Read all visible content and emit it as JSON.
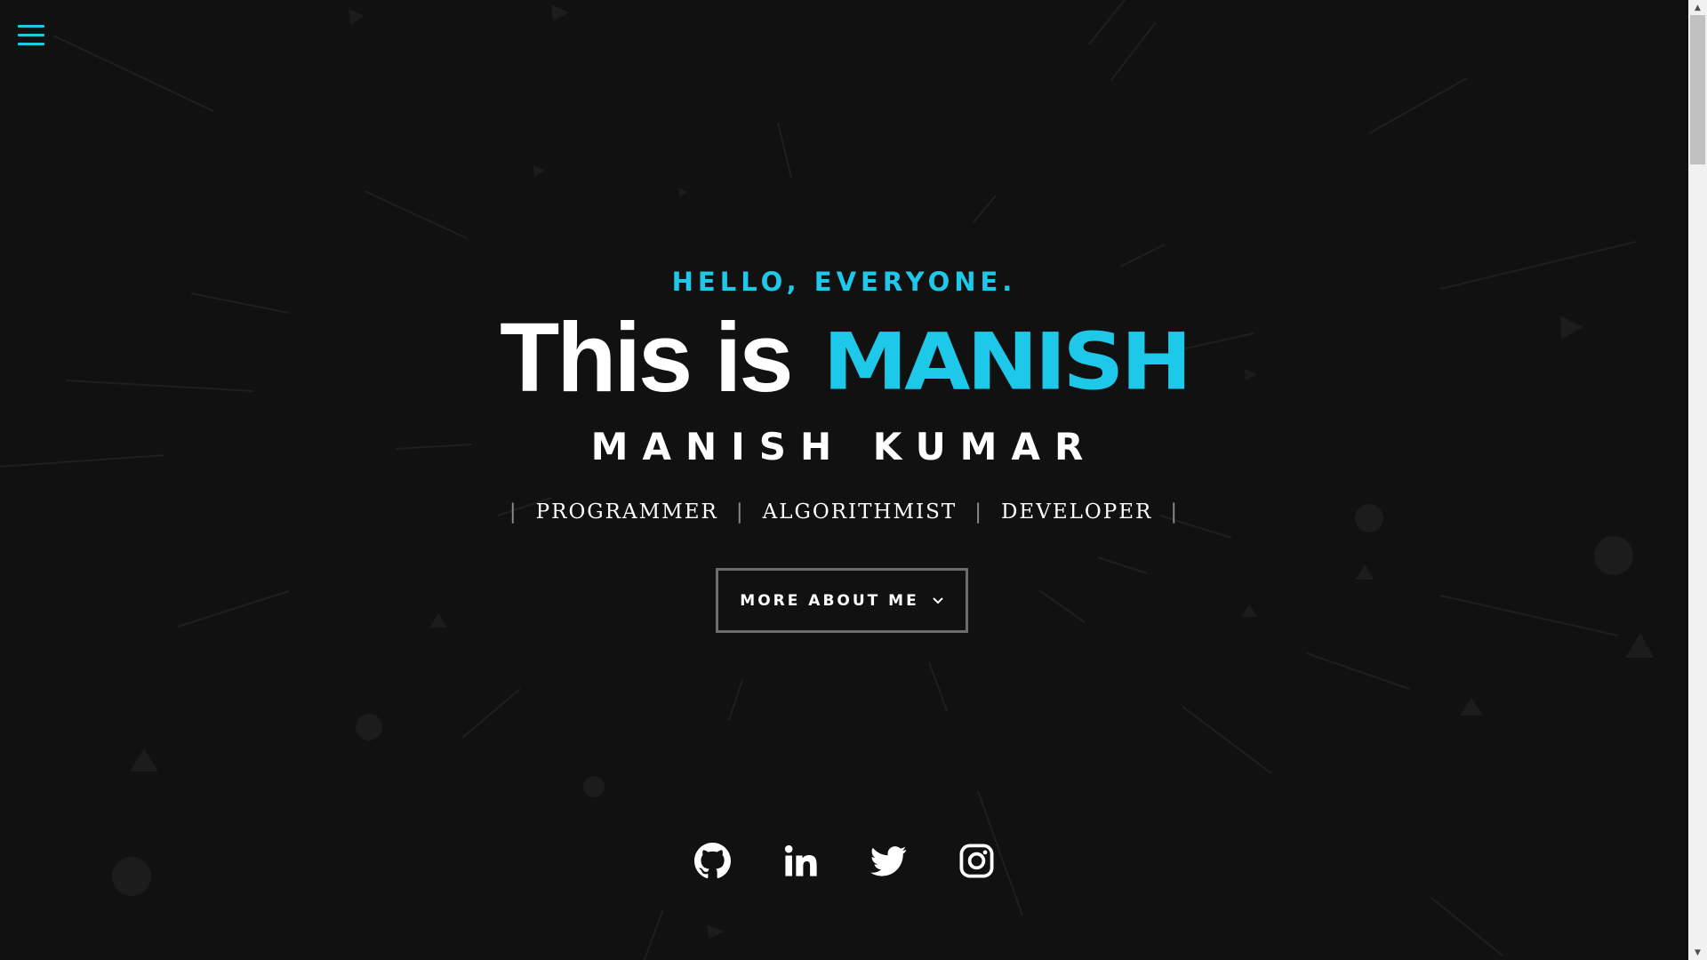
{
  "nav": {
    "menu_icon": "hamburger-menu-icon"
  },
  "hero": {
    "kicker": "HELLO, EVERYONE.",
    "headline_prefix": "This is",
    "logo_text": "MANISH",
    "full_name": "MANISH KUMAR",
    "roles": [
      "PROGRAMMER",
      "ALGORITHMIST",
      "DEVELOPER"
    ],
    "role_separator": "|",
    "cta_label": "MORE ABOUT ME"
  },
  "social": {
    "icons": [
      "github-icon",
      "linkedin-icon",
      "twitter-icon",
      "instagram-icon"
    ]
  },
  "colors": {
    "background": "#111111",
    "accent": "#1ec8e8",
    "text": "#ffffff",
    "button_border": "#6d6d6d"
  }
}
